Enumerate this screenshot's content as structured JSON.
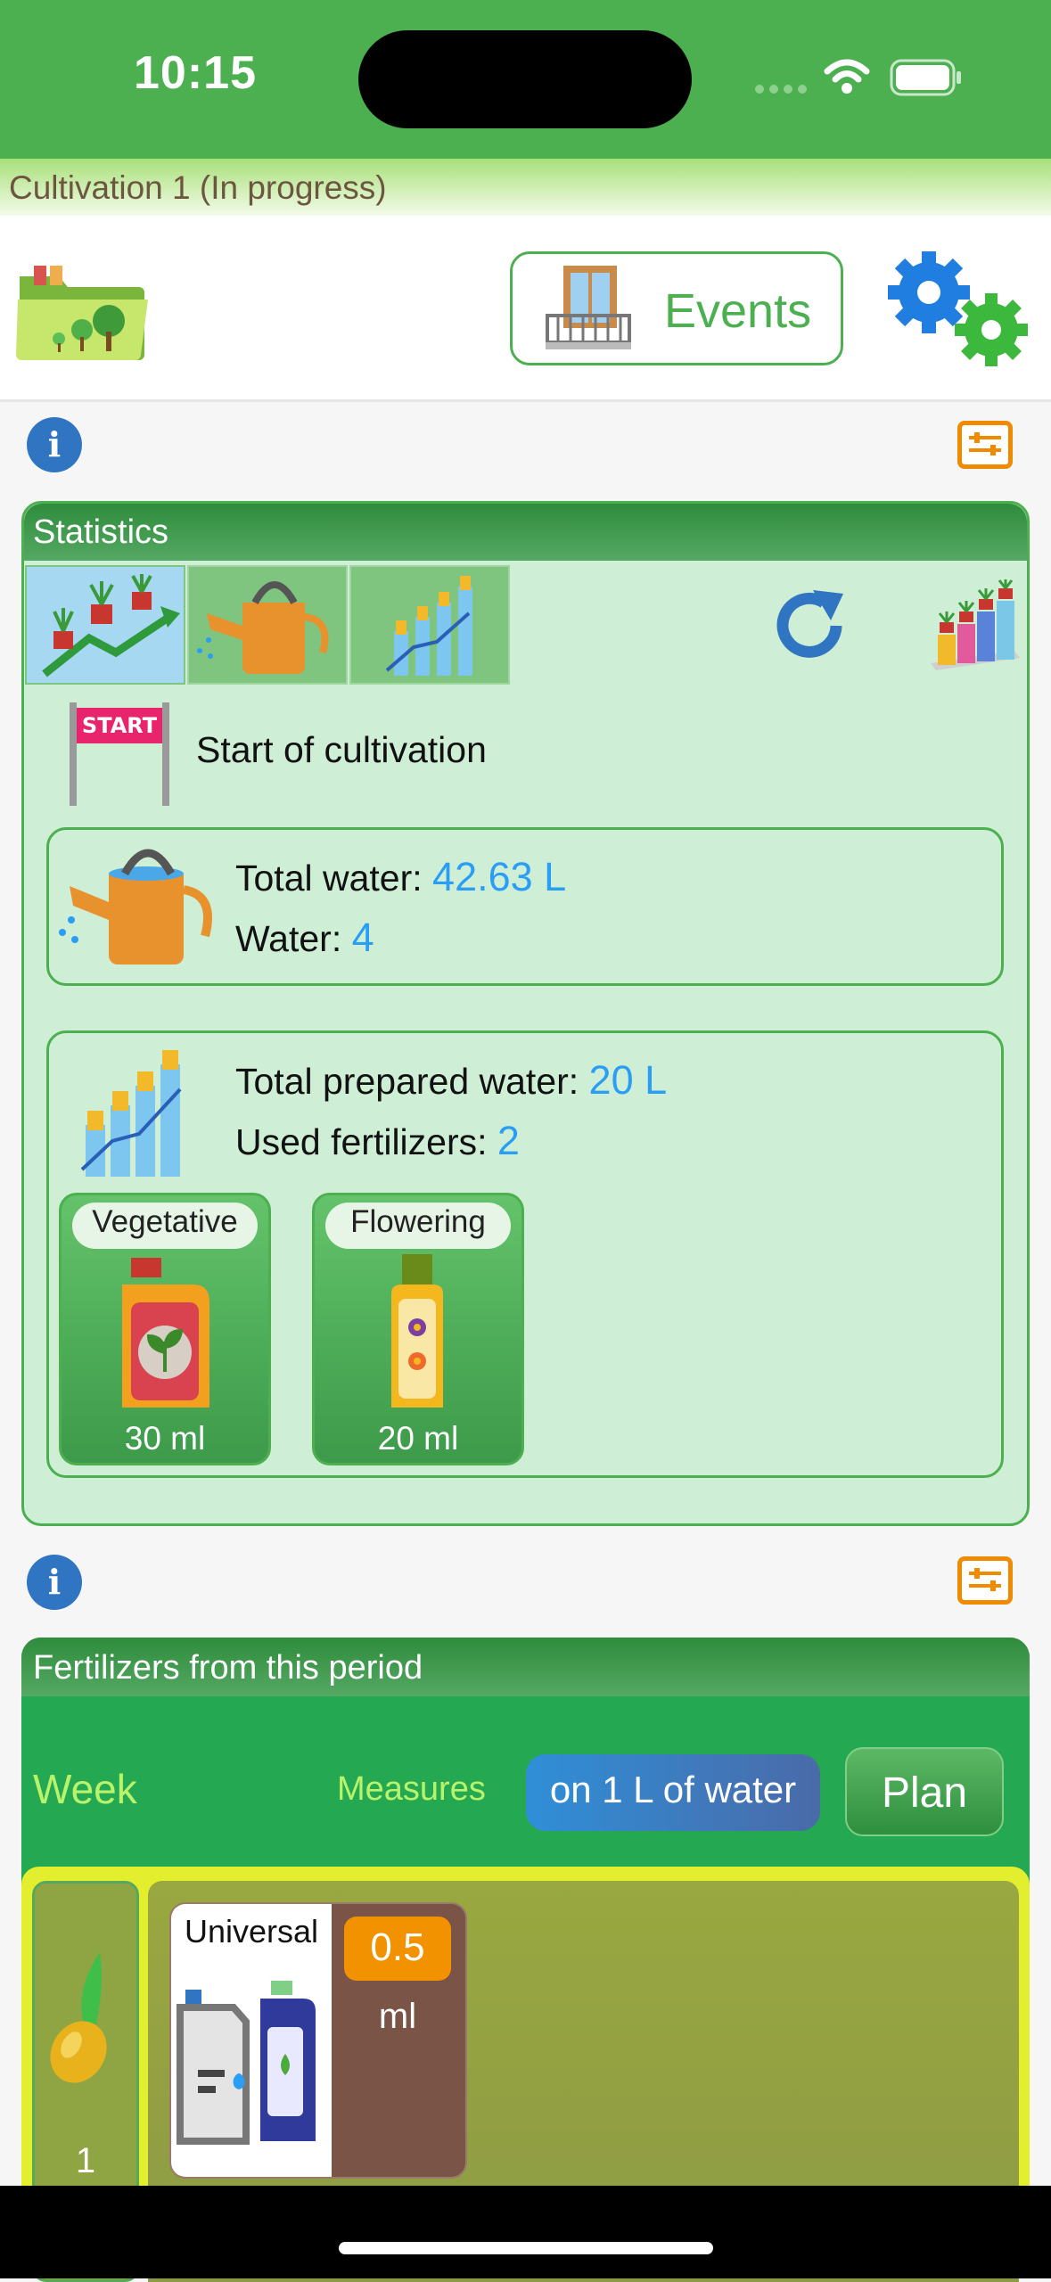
{
  "status_bar": {
    "time": "10:15"
  },
  "cultivation": {
    "title": "Cultivation 1 (In progress)"
  },
  "toolbar": {
    "events_label": "Events"
  },
  "statistics": {
    "title": "Statistics",
    "start_label": "Start of cultivation",
    "water": {
      "total_label": "Total water: ",
      "total_value": "42.63 L",
      "count_label": "Water: ",
      "count_value": "4"
    },
    "fertilizer": {
      "prepared_label": "Total prepared water: ",
      "prepared_value": "20 L",
      "used_label": "Used fertilizers: ",
      "used_value": "2",
      "items": [
        {
          "name": "Vegetative",
          "amount": "30 ml"
        },
        {
          "name": "Flowering",
          "amount": "20 ml"
        }
      ]
    }
  },
  "fertilizers_period": {
    "title": "Fertilizers from this period",
    "week_label": "Week",
    "measures_label": "Measures",
    "measure_option": "on 1 L of water",
    "plan_label": "Plan",
    "weeks": [
      {
        "number": "1",
        "items": [
          {
            "name": "Universal",
            "dose": "0.5",
            "unit": "ml"
          }
        ]
      }
    ]
  },
  "colors": {
    "primary": "#4caf50",
    "accent": "#2a9df4",
    "warning": "#f08a00",
    "info": "#2f75c2"
  }
}
